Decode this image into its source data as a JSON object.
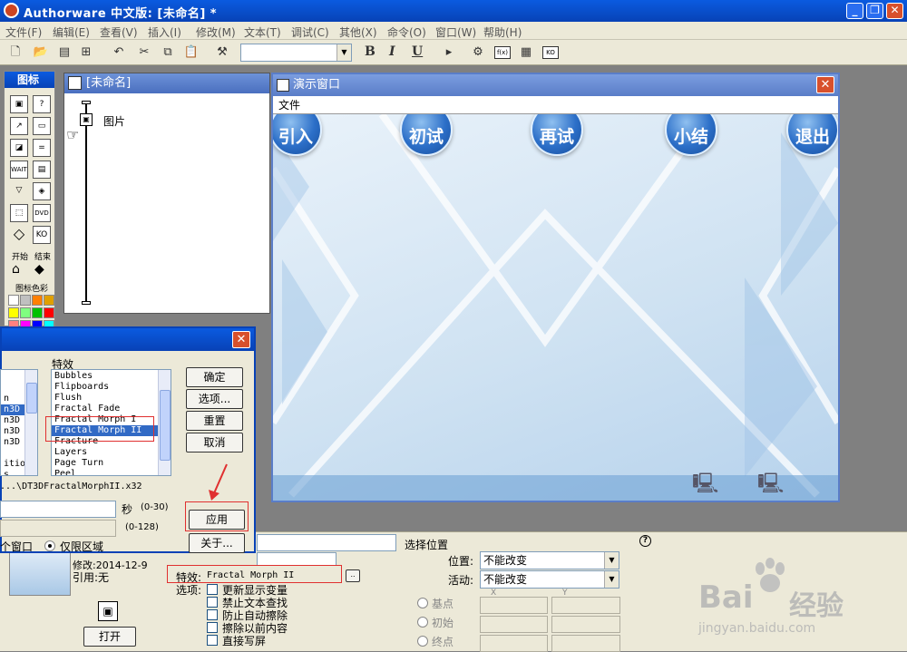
{
  "window": {
    "title": "Authorware 中文版: [未命名] *"
  },
  "menu": [
    "文件(F)",
    "编辑(E)",
    "查看(V)",
    "插入(I)",
    "修改(M)",
    "文本(T)",
    "调试(C)",
    "其他(X)",
    "命令(O)",
    "窗口(W)",
    "帮助(H)"
  ],
  "toolbar": {
    "bold": "B",
    "italic": "I",
    "underline": "U",
    "fx_label": "f(x)",
    "ko_label": "KO"
  },
  "palette": {
    "title": "图标",
    "start_label": "开始",
    "end_label": "结束",
    "colors_label": "图标色彩",
    "wait_label": "WAIT",
    "dvd_label": "DVD",
    "ko_label": "KO",
    "colors": [
      "#ffffff",
      "#c0c0c0",
      "#ff8000",
      "#e0a000",
      "#ffff00",
      "#80ff80",
      "#00c000",
      "#ff0000",
      "#ff8080",
      "#ff00ff",
      "#0000ff",
      "#00ffff"
    ]
  },
  "flow_window": {
    "title": "[未命名]",
    "icon_label": "图片"
  },
  "presentation": {
    "title": "演示窗口",
    "menu_file": "文件",
    "nav_buttons": [
      "引入",
      "初试",
      "再试",
      "小结",
      "退出"
    ]
  },
  "dialog": {
    "effects_label": "特效",
    "effects": [
      "Bubbles",
      "Flipboards",
      "Flush",
      "Fractal Fade",
      "Fractal Morph I",
      "Fractal Morph II",
      "Fracture",
      "Layers",
      "Page Turn",
      "Peel"
    ],
    "selected_effect": "Fractal Morph II",
    "left_list": [
      "n",
      "n3D",
      "n3D :",
      "n3D :",
      "n3D :",
      "",
      "itio",
      "s"
    ],
    "file_path": "...\\DT3DFractalMorphII.x32",
    "seconds_label": "秒",
    "seconds_range": "(0-30)",
    "smooth_range": "(0-128)",
    "window_label": "个窗口",
    "region_label": "仅限区域",
    "buttons": {
      "ok": "确定",
      "options": "选项...",
      "reset": "重置",
      "cancel": "取消",
      "apply": "应用",
      "about": "关于..."
    }
  },
  "properties": {
    "modified": "修改:2014-12-9",
    "reference": "引用:无",
    "open_button": "打开",
    "effect_label": "特效:",
    "effect_value": "Fractal Morph II",
    "options_label": "选项:",
    "options": [
      "更新显示变量",
      "禁止文本查找",
      "防止自动擦除",
      "擦除以前内容",
      "直接写屏"
    ],
    "select_position": "选择位置",
    "position_label": "位置:",
    "position_value": "不能改变",
    "active_label": "活动:",
    "active_value": "不能改变",
    "base_label": "基点",
    "initial_label": "初始",
    "end_label": "终点",
    "x_label": "X",
    "y_label": "Y",
    "help": "?"
  },
  "watermark": {
    "brand": "Bai",
    "brand2": "经验",
    "url": "jingyan.baidu.com"
  },
  "colors": {
    "titlebar": "#0842b6",
    "face": "#ece9d8",
    "highlight": "#e03030"
  }
}
